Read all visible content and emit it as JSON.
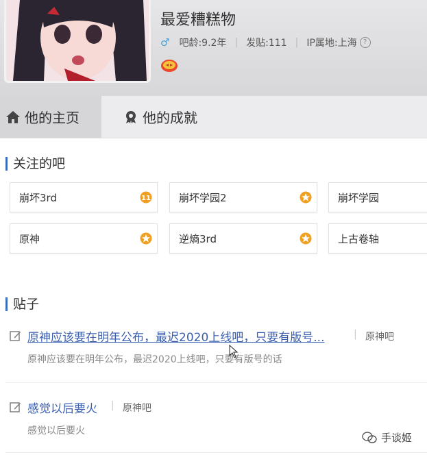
{
  "profile": {
    "username": "最爱糟糕物",
    "bar_age": "吧龄:9.2年",
    "posts": "发贴:111",
    "ip_location": "IP属地:上海",
    "help_glyph": "?"
  },
  "tabs": [
    {
      "label": "他的主页",
      "active": true
    },
    {
      "label": "他的成就",
      "active": false
    }
  ],
  "followed_section": {
    "title": "关注的吧",
    "bars": [
      {
        "name": "崩坏3rd",
        "level": "11"
      },
      {
        "name": "崩坏学园2",
        "level": ""
      },
      {
        "name": "崩坏学园",
        "level": ""
      },
      {
        "name": "原神",
        "level": ""
      },
      {
        "name": "逆熵3rd",
        "level": ""
      },
      {
        "name": "上古卷轴",
        "level": ""
      }
    ]
  },
  "posts_section": {
    "title": "贴子",
    "posts": [
      {
        "title": "原神应该要在明年公布，最迟2020上线吧，只要有版号...",
        "forum": "原神吧",
        "snippet": "原神应该要在明年公布，最迟2020上线吧，只要有版号的话"
      },
      {
        "title": "感觉以后要火",
        "forum": "原神吧",
        "snippet": "感觉以后要火"
      }
    ]
  },
  "watermark": {
    "label": "手谈姬"
  },
  "colors": {
    "accent": "#3a6fbf",
    "link": "#3b5fb0",
    "star": "#f0a020"
  }
}
